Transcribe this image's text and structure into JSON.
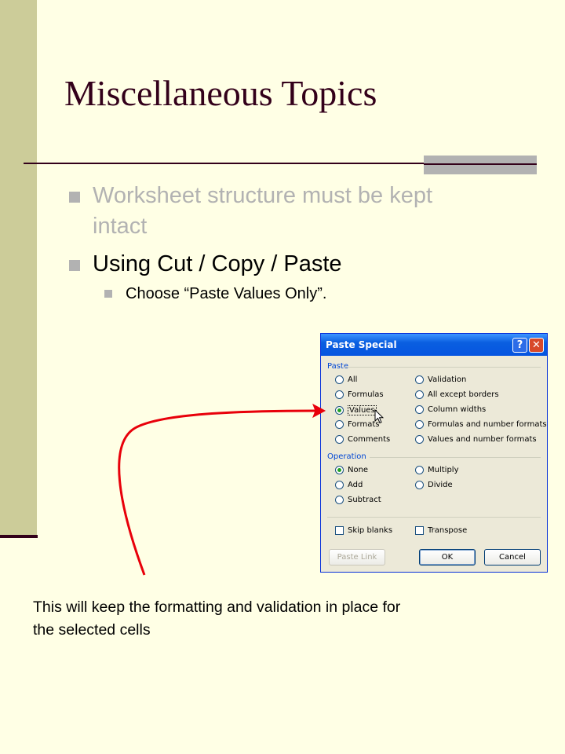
{
  "slide": {
    "title": "Miscellaneous Topics",
    "bullets": [
      {
        "text": "Worksheet structure must be kept intact",
        "dimmed": true
      },
      {
        "text": "Using Cut / Copy / Paste",
        "dimmed": false
      }
    ],
    "sub_bullet": "Choose “Paste Values Only”.",
    "caption": "This will keep the formatting and validation in place for the selected cells",
    "colors": {
      "background": "#FFFFE5",
      "accent_bar": "#CCCC99",
      "title": "#33001A",
      "dimmed_text": "#B2B2B2",
      "arrow": "#E8000A"
    }
  },
  "dialog": {
    "title": "Paste Special",
    "help_icon": "?",
    "close_icon": "✕",
    "paste_group_label": "Paste",
    "paste_options_left": [
      "All",
      "Formulas",
      "Values",
      "Formats",
      "Comments"
    ],
    "paste_options_right": [
      "Validation",
      "All except borders",
      "Column widths",
      "Formulas and number formats",
      "Values and number formats"
    ],
    "paste_selected": "Values",
    "operation_group_label": "Operation",
    "operation_options_left": [
      "None",
      "Add",
      "Subtract"
    ],
    "operation_options_right": [
      "Multiply",
      "Divide"
    ],
    "operation_selected": "None",
    "skip_blanks_label": "Skip blanks",
    "transpose_label": "Transpose",
    "paste_link_label": "Paste Link",
    "ok_label": "OK",
    "cancel_label": "Cancel"
  }
}
